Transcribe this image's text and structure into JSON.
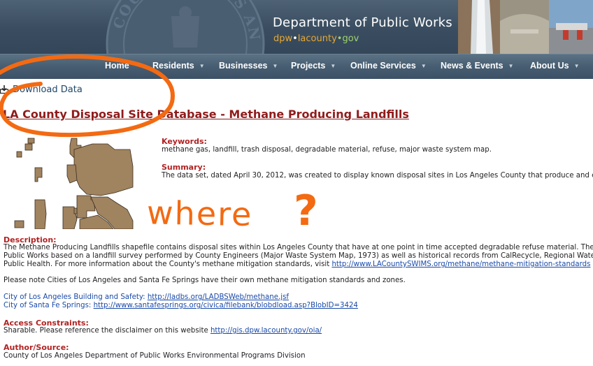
{
  "header": {
    "dept_title": "Department of Public Works",
    "url_part1": "dpw",
    "url_part2": "lacounty",
    "url_part3": "gov",
    "seal_text": "COUNTY OF LOS ANGELES"
  },
  "nav": {
    "items": [
      {
        "label": "Home"
      },
      {
        "label": "Residents"
      },
      {
        "label": "Businesses"
      },
      {
        "label": "Projects"
      },
      {
        "label": "Online Services"
      },
      {
        "label": "News & Events"
      },
      {
        "label": "About Us"
      }
    ]
  },
  "download_label": "Download Data",
  "page_title": "LA County Disposal Site Database - Methane Producing Landfills",
  "keywords": {
    "label": "Keywords:",
    "text": "methane gas, landfill, trash disposal, degradable material, refuse, major waste system map."
  },
  "summary": {
    "label": "Summary:",
    "text": "The data set, dated April 30, 2012, was created to display known disposal sites in Los Angeles County that produce and e"
  },
  "annotation": {
    "word": "where",
    "mark": "?",
    "color": "#f36a12"
  },
  "description": {
    "label": "Description:",
    "line1": "The Methane Producing Landfills shapefile contains disposal sites within Los Angeles County that have at one point in time accepted degradable refuse material. The s",
    "line2": "Public Works based on a landfill survey performed by County Engineers (Major Waste System Map, 1973) as well as historical records from CalRecycle, Regional Wate",
    "line3_prefix": "Public Health. For more information about the County's methane mitigation standards, visit ",
    "line3_link": "http://www.LACountySWIMS.org/methane/methane-mitigation-standards"
  },
  "note": "Please note Cities of Los Angeles and Santa Fe Springs have their own methane mitigation standards and zones.",
  "city_links": [
    {
      "label": "City of Los Angeles Building and Safety:",
      "url": "http://ladbs.org/LADBSWeb/methane.jsf"
    },
    {
      "label": "City of Santa Fe Springs:",
      "url": "http://www.santafesprings.org/civica/filebank/blobdload.asp?BlobID=3424"
    }
  ],
  "access": {
    "label": "Access Constraints:",
    "text_prefix": "Sharable. Please reference the disclaimer on this website ",
    "link": "http://gis.dpw.lacounty.gov/oia/"
  },
  "author": {
    "label": "Author/Source:",
    "text": "County of Los Angeles Department of Public Works Environmental Programs Division"
  },
  "colors": {
    "header_bg": "#3a4d60",
    "title_red": "#8f1c1c",
    "label_red": "#b22222",
    "link_blue": "#1a4aa8",
    "map_fill": "#a0835f"
  }
}
